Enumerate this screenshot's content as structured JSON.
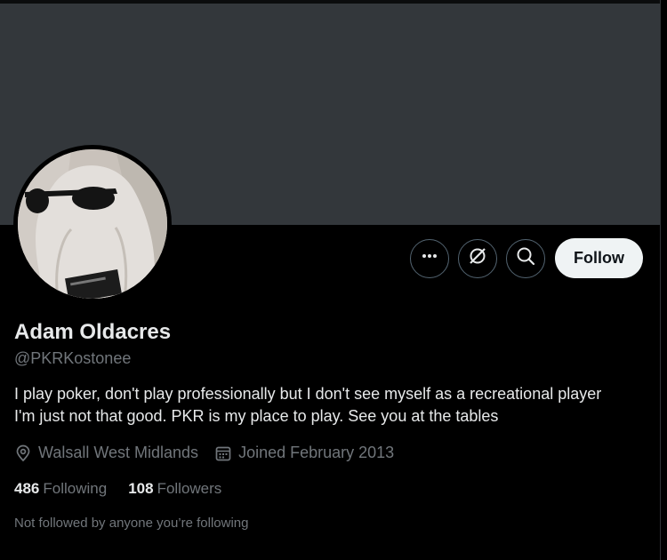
{
  "profile": {
    "name": "Adam Oldacres",
    "handle": "@PKRKostonee",
    "bio_lines": [
      "I play poker, don't play professionally but I don't see myself as a recreational player",
      "I'm just not that good. PKR is my place to play. See you at the tables"
    ],
    "location": "Walsall West Midlands",
    "joined": "Joined February 2013",
    "following_count": "486",
    "following_label": "Following",
    "followers_count": "108",
    "followers_label": "Followers",
    "followed_by_note": "Not followed by anyone you’re following"
  },
  "actions": {
    "more_icon": "more-horizontal-icon",
    "grok_icon": "grok-icon",
    "search_icon": "search-icon",
    "follow_label": "Follow"
  },
  "colors": {
    "background": "#000000",
    "banner": "#33373b",
    "primary_text": "#e7e9ea",
    "secondary_text": "#71767b",
    "button_border": "#536471",
    "follow_bg": "#eff3f4",
    "follow_text": "#0f1419"
  }
}
